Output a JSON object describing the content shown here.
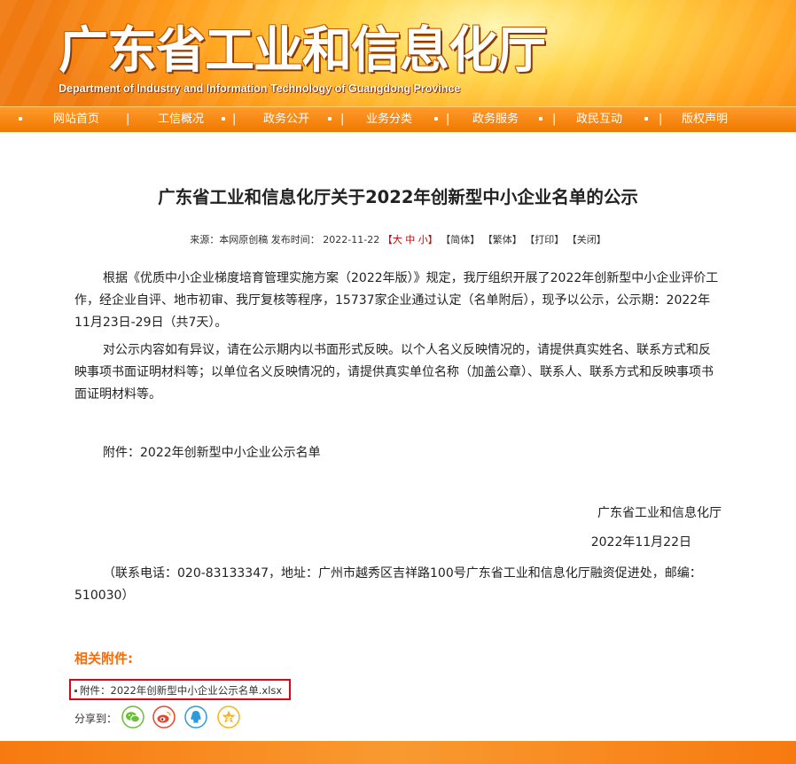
{
  "header": {
    "title": "广东省工业和信息化厅",
    "subtitle": "Department of Industry and Information Technology of Guangdong Province"
  },
  "nav": {
    "items": [
      "网站首页",
      "工信概况",
      "政务公开",
      "业务分类",
      "政务服务",
      "政民互动",
      "版权声明"
    ]
  },
  "article": {
    "title": "广东省工业和信息化厅关于2022年创新型中小企业名单的公示",
    "meta": {
      "source": "来源：本网原创稿 发布时间： 2022-11-22",
      "font_open": "【",
      "font_large": "大",
      "font_medium": "中",
      "font_small": "小",
      "font_close": "】",
      "simplified": "【简体】",
      "traditional": "【繁体】",
      "print": "【打印】",
      "close": "【关闭】"
    },
    "paragraph1": "根据《优质中小企业梯度培育管理实施方案（2022年版）》规定，我厅组织开展了2022年创新型中小企业评价工作，经企业自评、地市初审、我厅复核等程序，15737家企业通过认定（名单附后），现予以公示，公示期：2022年11月23日-29日（共7天）。",
    "paragraph2": "对公示内容如有异议，请在公示期内以书面形式反映。以个人名义反映情况的，请提供真实姓名、联系方式和反映事项书面证明材料等；以单位名义反映情况的，请提供真实单位名称（加盖公章）、联系人、联系方式和反映事项书面证明材料等。",
    "attachment_line": "附件：2022年创新型中小企业公示名单",
    "signature_org": "广东省工业和信息化厅",
    "signature_date": "2022年11月22日",
    "contact": "（联系电话：020-83133347，地址：广州市越秀区吉祥路100号广东省工业和信息化厅融资促进处，邮编：510030）"
  },
  "related": {
    "title": "相关附件:",
    "attachment_link": "附件：2022年创新型中小企业公示名单.xlsx"
  },
  "share": {
    "label": "分享到：",
    "targets": [
      "wechat-icon",
      "weibo-icon",
      "qq-icon",
      "qzone-icon"
    ]
  },
  "colors": {
    "brand_orange": "#f07800",
    "accent_orange_text": "#ff6a00",
    "highlight_red": "#e60012",
    "wechat_green": "#6abe39",
    "weibo_red": "#e6452e",
    "qq_blue": "#2d9bd9",
    "qzone_yellow": "#f6b318"
  }
}
